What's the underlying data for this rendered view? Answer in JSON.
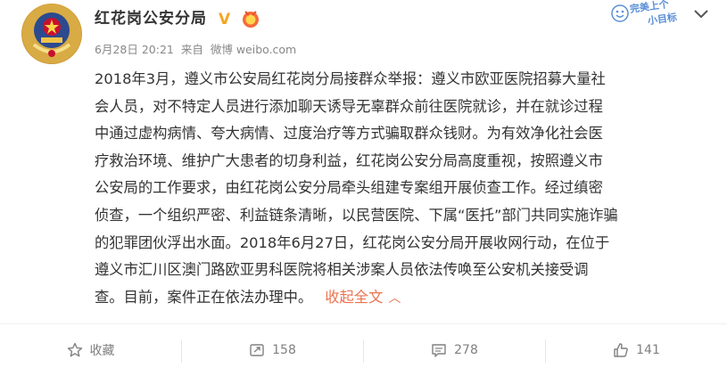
{
  "post": {
    "author": "红花岗公安分局",
    "verified_badge": "V",
    "meta": {
      "date": "6月28日 20:21",
      "source_prefix": "来自",
      "source": "微博 weibo.com"
    },
    "sticker": {
      "line1": "完美上个",
      "line2": "小目标"
    },
    "lines": [
      "2018年3月，遵义市公安局红花岗分局接群众举报：遵义市欧亚医院招募大量社",
      "会人员，对不特定人员进行添加聊天诱导无辜群众前往医院就诊，并在就诊过程",
      "中通过虚构病情、夸大病情、过度治疗等方式骗取群众钱财。为有效净化社会医",
      "疗救治环境、维护广大患者的切身利益，红花岗公安分局高度重视，按照遵义市",
      "公安局的工作要求，由红花岗公安分局牵头组建专案组开展侦查工作。经过缜密",
      "侦查，一个组织严密、利益链条清晰，以民营医院、下属“医托”部门共同实施诈骗",
      "的犯罪团伙浮出水面。2018年6月27日，红花岗公安分局开展收网行动，在位于",
      "遵义市汇川区澳门路欧亚男科医院将相关涉案人员依法传唤至公安机关接受调"
    ],
    "last_line": "查。目前，案件正在依法办理中。",
    "collapse_label": "收起全文",
    "collapse_arrow": "︿"
  },
  "footer": {
    "favorite_label": "收藏",
    "repost_count": "158",
    "comment_count": "278",
    "like_count": "141"
  },
  "colors": {
    "accent": "#eb7350",
    "text": "#333333",
    "meta": "#888888",
    "verified": "#f5a623"
  },
  "icons": {
    "avatar": "police-badge-avatar",
    "favorite": "star-icon",
    "repost": "repost-icon",
    "comment": "comment-icon",
    "like": "thumbs-up-icon",
    "more": "chevron-down-icon"
  }
}
